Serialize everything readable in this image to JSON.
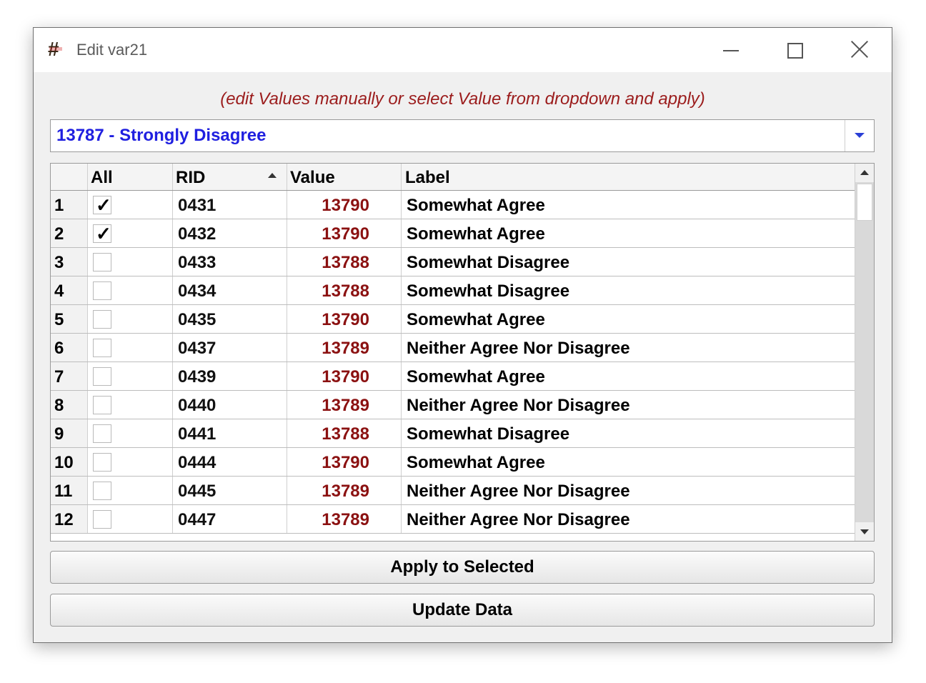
{
  "window": {
    "title": "Edit var21"
  },
  "hint": "(edit Values manually or select Value from dropdown and apply)",
  "dropdown": {
    "selected": "13787 - Strongly Disagree"
  },
  "table": {
    "columns": {
      "all": "All",
      "rid": "RID",
      "value": "Value",
      "label": "Label"
    },
    "rows": [
      {
        "num": "1",
        "checked": true,
        "rid": "0431",
        "value": "13790",
        "label": "Somewhat Agree"
      },
      {
        "num": "2",
        "checked": true,
        "rid": "0432",
        "value": "13790",
        "label": "Somewhat Agree"
      },
      {
        "num": "3",
        "checked": false,
        "rid": "0433",
        "value": "13788",
        "label": "Somewhat Disagree"
      },
      {
        "num": "4",
        "checked": false,
        "rid": "0434",
        "value": "13788",
        "label": "Somewhat Disagree"
      },
      {
        "num": "5",
        "checked": false,
        "rid": "0435",
        "value": "13790",
        "label": "Somewhat Agree"
      },
      {
        "num": "6",
        "checked": false,
        "rid": "0437",
        "value": "13789",
        "label": "Neither Agree Nor Disagree"
      },
      {
        "num": "7",
        "checked": false,
        "rid": "0439",
        "value": "13790",
        "label": "Somewhat Agree"
      },
      {
        "num": "8",
        "checked": false,
        "rid": "0440",
        "value": "13789",
        "label": "Neither Agree Nor Disagree"
      },
      {
        "num": "9",
        "checked": false,
        "rid": "0441",
        "value": "13788",
        "label": "Somewhat Disagree"
      },
      {
        "num": "10",
        "checked": false,
        "rid": "0444",
        "value": "13790",
        "label": "Somewhat Agree"
      },
      {
        "num": "11",
        "checked": false,
        "rid": "0445",
        "value": "13789",
        "label": "Neither Agree Nor Disagree"
      },
      {
        "num": "12",
        "checked": false,
        "rid": "0447",
        "value": "13789",
        "label": "Neither Agree Nor Disagree"
      }
    ]
  },
  "buttons": {
    "apply": "Apply to Selected",
    "update": "Update Data"
  },
  "colors": {
    "hint": "#9b1c1c",
    "dropdown_text": "#1f1fe0",
    "value_text": "#8b1111"
  },
  "icons": {
    "app": "hash-icon",
    "minimize": "minimize-icon",
    "maximize": "maximize-icon",
    "close": "close-icon"
  }
}
